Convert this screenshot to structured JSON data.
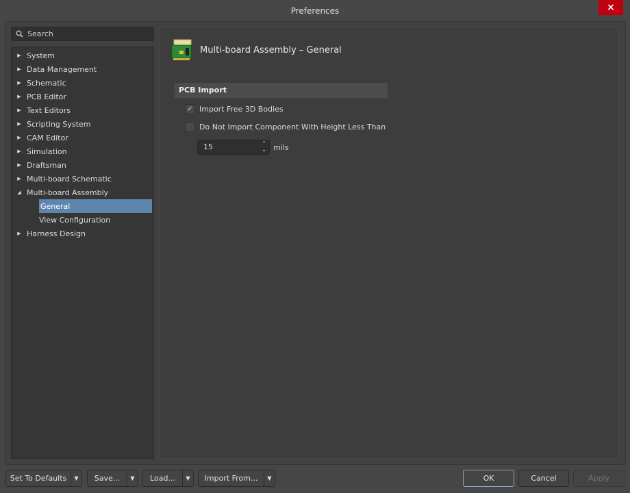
{
  "window": {
    "title": "Preferences",
    "close_icon": "×"
  },
  "search": {
    "placeholder": "Search"
  },
  "tree": [
    {
      "label": "System",
      "state": "collapsed"
    },
    {
      "label": "Data Management",
      "state": "collapsed"
    },
    {
      "label": "Schematic",
      "state": "collapsed"
    },
    {
      "label": "PCB Editor",
      "state": "collapsed"
    },
    {
      "label": "Text Editors",
      "state": "collapsed"
    },
    {
      "label": "Scripting System",
      "state": "collapsed"
    },
    {
      "label": "CAM Editor",
      "state": "collapsed"
    },
    {
      "label": "Simulation",
      "state": "collapsed"
    },
    {
      "label": "Draftsman",
      "state": "collapsed"
    },
    {
      "label": "Multi-board Schematic",
      "state": "collapsed"
    },
    {
      "label": "Multi-board Assembly",
      "state": "expanded",
      "children": [
        {
          "label": "General",
          "selected": true
        },
        {
          "label": "View Configuration"
        }
      ]
    },
    {
      "label": "Harness Design",
      "state": "collapsed"
    }
  ],
  "page": {
    "title": "Multi-board Assembly – General",
    "section": "PCB Import",
    "import_free_3d": {
      "label": "Import Free 3D Bodies",
      "checked": true
    },
    "do_not_import": {
      "label": "Do Not Import Component With Height Less Than",
      "checked": false
    },
    "height_value": "15",
    "height_units": "mils"
  },
  "footer": {
    "set_defaults": "Set To Defaults",
    "save": "Save...",
    "load": "Load...",
    "import_from": "Import From...",
    "ok": "OK",
    "cancel": "Cancel",
    "apply": "Apply"
  },
  "colors": {
    "selection": "#5e86ad",
    "close": "#c0000f"
  }
}
